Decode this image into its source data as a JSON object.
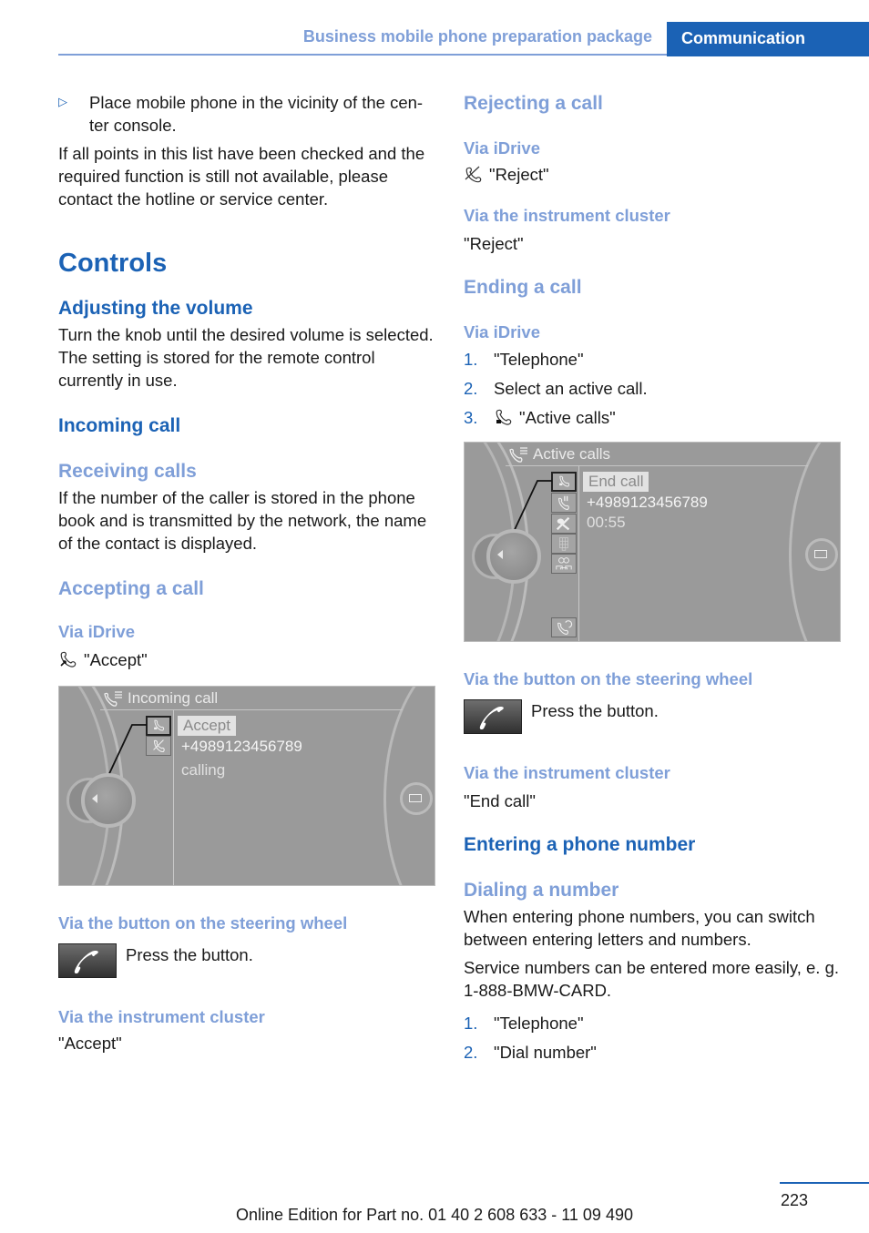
{
  "header": {
    "section": "Business mobile phone preparation package",
    "chapter": "Communication"
  },
  "left": {
    "bullet_item": "Place mobile phone in the vicinity of the center console.",
    "bullet_line1": "Place mobile phone in the vicinity of the cen-",
    "bullet_line2": "ter console.",
    "note": "If all points in this list have been checked and the required function is still not available, please contact the hotline or service center.",
    "controls_title": "Controls",
    "volume_title": "Adjusting the volume",
    "volume_text": "Turn the knob until the desired volume is selected. The setting is stored for the remote control currently in use.",
    "incoming_title": "Incoming call",
    "receiving_title": "Receiving calls",
    "receiving_text": "If the number of the caller is stored in the phone book and is transmitted by the network, the name of the contact is displayed.",
    "accepting_title": "Accepting a call",
    "via_idrive": "Via iDrive",
    "accept_item": "\"Accept\"",
    "screen": {
      "title": "Incoming call",
      "selected_item": "Accept",
      "number": "+4989123456789",
      "status": "calling"
    },
    "via_steering": "Via the button on the steering wheel",
    "press_button": "Press the button.",
    "via_cluster": "Via the instrument cluster",
    "cluster_value": "\"Accept\""
  },
  "right": {
    "rejecting_title": "Rejecting a call",
    "via_idrive": "Via iDrive",
    "reject_item": "\"Reject\"",
    "via_cluster": "Via the instrument cluster",
    "reject_cluster": "\"Reject\"",
    "ending_title": "Ending a call",
    "via_idrive_2": "Via iDrive",
    "end_steps": [
      {
        "num": "1.",
        "text": "\"Telephone\""
      },
      {
        "num": "2.",
        "text": "Select an active call."
      },
      {
        "num": "3.",
        "text": "\"Active calls\""
      }
    ],
    "screen": {
      "title": "Active calls",
      "selected_item": "End call",
      "number": "+4989123456789",
      "duration": "00:55"
    },
    "via_steering": "Via the button on the steering wheel",
    "press_button": "Press the button.",
    "via_cluster_2": "Via the instrument cluster",
    "end_cluster": "\"End call\"",
    "entering_title": "Entering a phone number",
    "dialing_title": "Dialing a number",
    "dialing_text": "When entering phone numbers, you can switch between entering letters and numbers.",
    "service_text": "Service numbers can be entered more easily, e. g. 1-888-BMW-CARD.",
    "dial_steps": [
      {
        "num": "1.",
        "text": "\"Telephone\""
      },
      {
        "num": "2.",
        "text": "\"Dial number\""
      }
    ]
  },
  "footer": {
    "edition": "Online Edition for Part no. 01 40 2 608 633 - 11 09 490",
    "page_number": "223"
  },
  "colors": {
    "primary_blue": "#1b62b5",
    "light_blue": "#7f9fd8",
    "screen_gray": "#9a9a9a"
  }
}
